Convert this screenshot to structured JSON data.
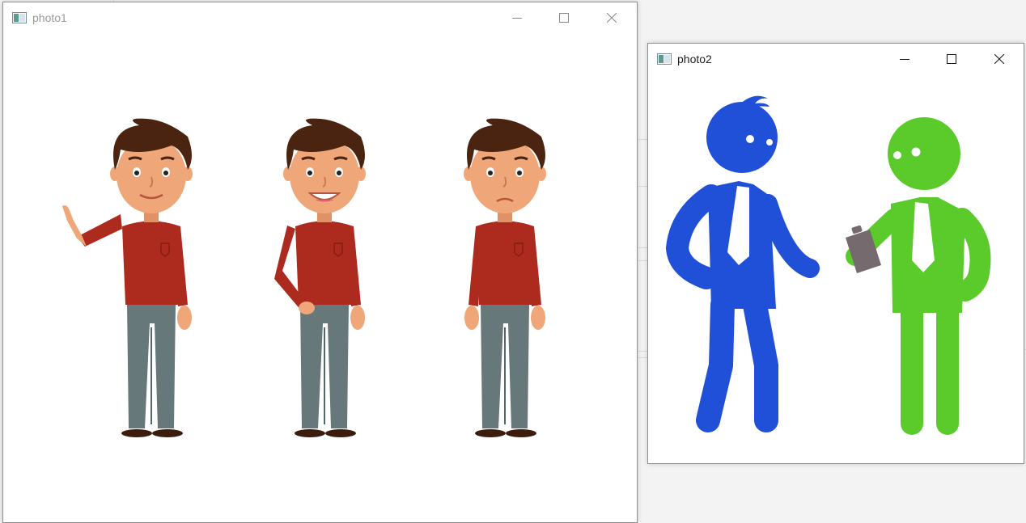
{
  "windows": [
    {
      "title": "photo1",
      "active": false,
      "icon": "image-window-icon",
      "controls": [
        "minimize-icon",
        "maximize-icon",
        "close-icon"
      ],
      "content": {
        "description_icon": "cartoon-men-illustration",
        "figures": [
          "waving",
          "smiling",
          "frowning"
        ],
        "colors": {
          "shirt": "#ad2a1e",
          "pants": "#66787a",
          "skin": "#efa77a",
          "hair": "#4a2410",
          "shoes": "#3b1c0e"
        }
      }
    },
    {
      "title": "photo2",
      "active": true,
      "icon": "image-window-icon",
      "controls": [
        "minimize-icon",
        "maximize-icon",
        "close-icon"
      ],
      "content": {
        "description_icon": "stick-figures-illustration",
        "colors": {
          "blue_figure": "#2050d8",
          "green_figure": "#5acb2a",
          "clipboard": "#756a6e"
        }
      }
    }
  ]
}
